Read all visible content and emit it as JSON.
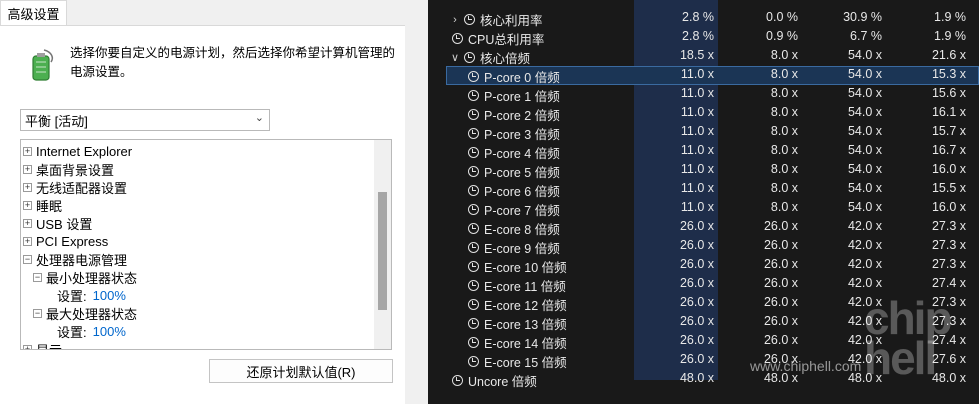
{
  "dialog": {
    "tab_label": "高级设置",
    "description": "选择你要自定义的电源计划，然后选择你希望计算机管理的电源设置。",
    "plan_select": "平衡 [活动]",
    "restore_button": "还原计划默认值(R)",
    "tree": [
      {
        "label": "Internet Explorer",
        "expander": "+",
        "level": 0
      },
      {
        "label": "桌面背景设置",
        "expander": "+",
        "level": 0
      },
      {
        "label": "无线适配器设置",
        "expander": "+",
        "level": 0
      },
      {
        "label": "睡眠",
        "expander": "+",
        "level": 0
      },
      {
        "label": "USB 设置",
        "expander": "+",
        "level": 0
      },
      {
        "label": "PCI Express",
        "expander": "+",
        "level": 0
      },
      {
        "label": "处理器电源管理",
        "expander": "−",
        "level": 0
      },
      {
        "label": "最小处理器状态",
        "expander": "−",
        "level": 1
      },
      {
        "label": "设置:",
        "value": "100%",
        "level": 2
      },
      {
        "label": "最大处理器状态",
        "expander": "−",
        "level": 1
      },
      {
        "label": "设置:",
        "value": "100%",
        "level": 2
      },
      {
        "label": "显示",
        "expander": "+",
        "level": 0
      }
    ]
  },
  "sensors": {
    "rows": [
      {
        "name": "核心利用率",
        "icon": "clock",
        "arrow": ">",
        "indent": 0,
        "v": [
          "2.8 %",
          "0.0 %",
          "30.9 %",
          "1.9 %"
        ]
      },
      {
        "name": "CPU总利用率",
        "icon": "clock",
        "arrow": "",
        "indent": 0,
        "v": [
          "2.8 %",
          "0.9 %",
          "6.7 %",
          "1.9 %"
        ]
      },
      {
        "name": "核心倍频",
        "icon": "clock",
        "arrow": "v",
        "indent": 0,
        "v": [
          "18.5 x",
          "8.0 x",
          "54.0 x",
          "21.6 x"
        ]
      },
      {
        "name": "P-core 0 倍频",
        "icon": "clock",
        "arrow": "",
        "indent": 1,
        "selected": true,
        "v": [
          "11.0 x",
          "8.0 x",
          "54.0 x",
          "15.3 x"
        ]
      },
      {
        "name": "P-core 1 倍频",
        "icon": "clock",
        "arrow": "",
        "indent": 1,
        "v": [
          "11.0 x",
          "8.0 x",
          "54.0 x",
          "15.6 x"
        ]
      },
      {
        "name": "P-core 2 倍频",
        "icon": "clock",
        "arrow": "",
        "indent": 1,
        "v": [
          "11.0 x",
          "8.0 x",
          "54.0 x",
          "16.1 x"
        ]
      },
      {
        "name": "P-core 3 倍频",
        "icon": "clock",
        "arrow": "",
        "indent": 1,
        "v": [
          "11.0 x",
          "8.0 x",
          "54.0 x",
          "15.7 x"
        ]
      },
      {
        "name": "P-core 4 倍频",
        "icon": "clock",
        "arrow": "",
        "indent": 1,
        "v": [
          "11.0 x",
          "8.0 x",
          "54.0 x",
          "16.7 x"
        ]
      },
      {
        "name": "P-core 5 倍频",
        "icon": "clock",
        "arrow": "",
        "indent": 1,
        "v": [
          "11.0 x",
          "8.0 x",
          "54.0 x",
          "16.0 x"
        ]
      },
      {
        "name": "P-core 6 倍频",
        "icon": "clock",
        "arrow": "",
        "indent": 1,
        "v": [
          "11.0 x",
          "8.0 x",
          "54.0 x",
          "15.5 x"
        ]
      },
      {
        "name": "P-core 7 倍频",
        "icon": "clock",
        "arrow": "",
        "indent": 1,
        "v": [
          "11.0 x",
          "8.0 x",
          "54.0 x",
          "16.0 x"
        ]
      },
      {
        "name": "E-core 8 倍频",
        "icon": "clock",
        "arrow": "",
        "indent": 1,
        "v": [
          "26.0 x",
          "26.0 x",
          "42.0 x",
          "27.3 x"
        ]
      },
      {
        "name": "E-core 9 倍频",
        "icon": "clock",
        "arrow": "",
        "indent": 1,
        "v": [
          "26.0 x",
          "26.0 x",
          "42.0 x",
          "27.3 x"
        ]
      },
      {
        "name": "E-core 10 倍频",
        "icon": "clock",
        "arrow": "",
        "indent": 1,
        "v": [
          "26.0 x",
          "26.0 x",
          "42.0 x",
          "27.3 x"
        ]
      },
      {
        "name": "E-core 11 倍频",
        "icon": "clock",
        "arrow": "",
        "indent": 1,
        "v": [
          "26.0 x",
          "26.0 x",
          "42.0 x",
          "27.4 x"
        ]
      },
      {
        "name": "E-core 12 倍频",
        "icon": "clock",
        "arrow": "",
        "indent": 1,
        "v": [
          "26.0 x",
          "26.0 x",
          "42.0 x",
          "27.3 x"
        ]
      },
      {
        "name": "E-core 13 倍频",
        "icon": "clock",
        "arrow": "",
        "indent": 1,
        "v": [
          "26.0 x",
          "26.0 x",
          "42.0 x",
          "27.3 x"
        ]
      },
      {
        "name": "E-core 14 倍频",
        "icon": "clock",
        "arrow": "",
        "indent": 1,
        "v": [
          "26.0 x",
          "26.0 x",
          "42.0 x",
          "27.4 x"
        ]
      },
      {
        "name": "E-core 15 倍频",
        "icon": "clock",
        "arrow": "",
        "indent": 1,
        "v": [
          "26.0 x",
          "26.0 x",
          "42.0 x",
          "27.6 x"
        ]
      },
      {
        "name": "Uncore 倍频",
        "icon": "clock",
        "arrow": "",
        "indent": 0,
        "v": [
          "48.0 x",
          "48.0 x",
          "48.0 x",
          "48.0 x"
        ]
      }
    ]
  },
  "watermark": {
    "url": "www.chiphell.com",
    "logo": "chip hell"
  },
  "colors": {
    "dark_bg": "#191919",
    "column_highlight": "#1e2d4a",
    "selection": "#1b3555",
    "link_blue": "#0066cc"
  }
}
